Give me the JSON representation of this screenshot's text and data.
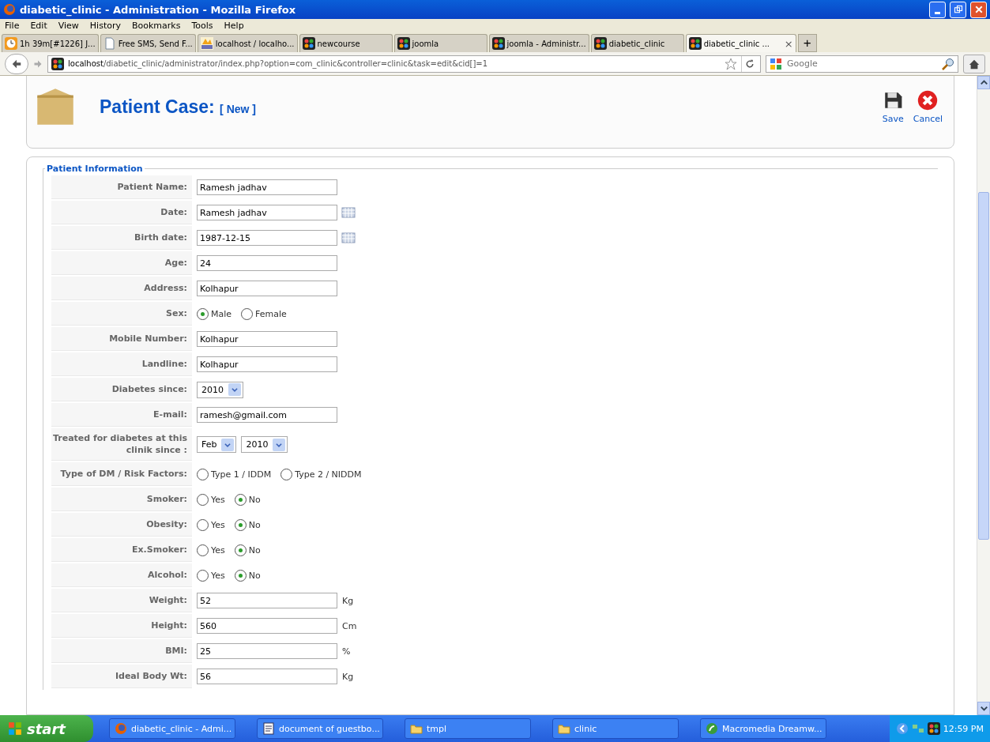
{
  "window": {
    "title": "diabetic_clinic - Administration - Mozilla Firefox"
  },
  "menu": [
    "File",
    "Edit",
    "View",
    "History",
    "Bookmarks",
    "Tools",
    "Help"
  ],
  "tabs": [
    {
      "label": "1h 39m[#1226] J...",
      "selected": false
    },
    {
      "label": "Free SMS, Send F...",
      "selected": false
    },
    {
      "label": "localhost / localho...",
      "selected": false
    },
    {
      "label": "newcourse",
      "selected": false
    },
    {
      "label": "joomla",
      "selected": false
    },
    {
      "label": "joomla - Administr...",
      "selected": false
    },
    {
      "label": "diabetic_clinic",
      "selected": false
    },
    {
      "label": "diabetic_clinic ...",
      "selected": true
    }
  ],
  "tab_close": "×",
  "new_tab": "+",
  "address": {
    "host": "localhost",
    "path": "/diabetic_clinic/administrator/index.php?option=com_clinic&controller=clinic&task=edit&cid[]=1"
  },
  "search": {
    "placeholder": "Google"
  },
  "header": {
    "title": "Patient Case:",
    "subtitle": "[ New ]"
  },
  "toolbar": [
    {
      "label": "Save"
    },
    {
      "label": "Cancel"
    }
  ],
  "legend": "Patient Information",
  "rows": [
    {
      "kind": "text",
      "label": "Patient Name:",
      "value": "Ramesh jadhav"
    },
    {
      "kind": "text",
      "label": "Date:",
      "value": "Ramesh jadhav",
      "calendar": true
    },
    {
      "kind": "text",
      "label": "Birth date:",
      "value": "1987-12-15",
      "calendar": true
    },
    {
      "kind": "text",
      "label": "Age:",
      "value": "24"
    },
    {
      "kind": "text",
      "label": "Address:",
      "value": "Kolhapur"
    },
    {
      "kind": "radio",
      "label": "Sex:",
      "options": [
        {
          "label": "Male",
          "selected": true
        },
        {
          "label": "Female",
          "selected": false
        }
      ]
    },
    {
      "kind": "text",
      "label": "Mobile Number:",
      "value": "Kolhapur"
    },
    {
      "kind": "text",
      "label": "Landline:",
      "value": "Kolhapur"
    },
    {
      "kind": "select",
      "label": "Diabetes since:",
      "selects": [
        "2010"
      ]
    },
    {
      "kind": "text",
      "label": "E-mail:",
      "value": "ramesh@gmail.com"
    },
    {
      "kind": "select",
      "label": "Treated for diabetes at this clinik since :",
      "selects": [
        "Feb",
        "2010"
      ]
    },
    {
      "kind": "radio",
      "label": "Type of DM / Risk Factors:",
      "options": [
        {
          "label": "Type 1 / IDDM",
          "selected": false
        },
        {
          "label": "Type 2 / NIDDM",
          "selected": false
        }
      ]
    },
    {
      "kind": "radio",
      "label": "Smoker:",
      "options": [
        {
          "label": "Yes",
          "selected": false
        },
        {
          "label": "No",
          "selected": true
        }
      ]
    },
    {
      "kind": "radio",
      "label": "Obesity:",
      "options": [
        {
          "label": "Yes",
          "selected": false
        },
        {
          "label": "No",
          "selected": true
        }
      ]
    },
    {
      "kind": "radio",
      "label": "Ex.Smoker:",
      "options": [
        {
          "label": "Yes",
          "selected": false
        },
        {
          "label": "No",
          "selected": true
        }
      ]
    },
    {
      "kind": "radio",
      "label": "Alcohol:",
      "options": [
        {
          "label": "Yes",
          "selected": false
        },
        {
          "label": "No",
          "selected": true
        }
      ]
    },
    {
      "kind": "text",
      "label": "Weight:",
      "value": "52",
      "unit": "Kg"
    },
    {
      "kind": "text",
      "label": "Height:",
      "value": "560",
      "unit": "Cm"
    },
    {
      "kind": "text",
      "label": "BMI:",
      "value": "25",
      "unit": "%"
    },
    {
      "kind": "text",
      "label": "Ideal Body Wt:",
      "value": "56",
      "unit": "Kg"
    }
  ],
  "taskbar": {
    "start": "start",
    "tasks": [
      {
        "label": "diabetic_clinic - Admi..."
      },
      {
        "label": "document of guestbo..."
      },
      {
        "label": "tmpl"
      },
      {
        "label": "clinic"
      },
      {
        "label": "Macromedia Dreamw..."
      }
    ],
    "clock": "12:59 PM"
  }
}
